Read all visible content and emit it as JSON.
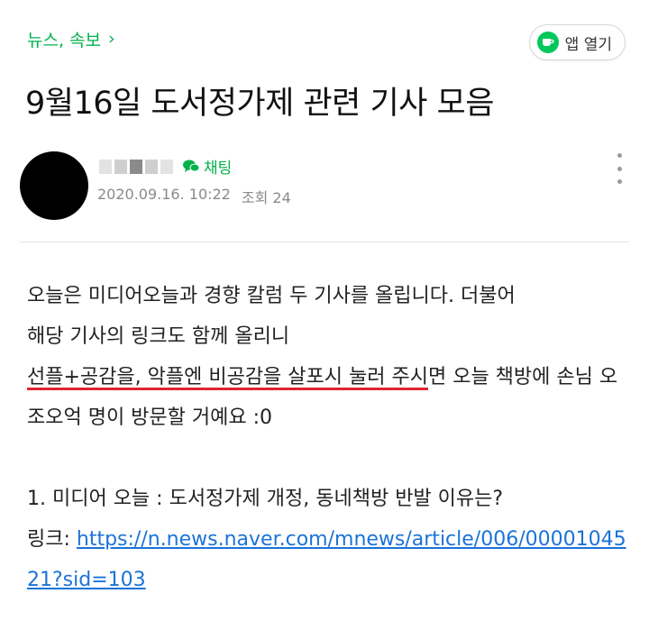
{
  "header": {
    "breadcrumb": "뉴스, 속보",
    "app_open_label": "앱 열기"
  },
  "post": {
    "title": "9월16일 도서정가제 관련 기사 모음",
    "chat_label": "채팅",
    "date": "2020.09.16. 10:22",
    "views": "조회 24"
  },
  "body": {
    "para1_line1": "오늘은 미디어오늘과 경향 칼럼 두 기사를 올립니다. 더불어",
    "para1_line2": "해당 기사의 링크도 함께 올리니",
    "para1_underlined": "선플+공감을, 악플엔 비공감을 살포시 눌러 주시",
    "para1_rest": "면 오늘 책방에 손님 오조오억 명이 방문할 거예요 :0",
    "item1_title": "1. 미디어 오늘 : 도서정가제 개정, 동네책방 반발 이유는?",
    "link_label": "링크: ",
    "link_url": "https://n.news.naver.com/mnews/article/006/0000104521?sid=103"
  },
  "colors": {
    "brand_green": "#03b14b",
    "link_blue": "#1b73d8",
    "underline_red": "#e0242e"
  },
  "icons": {
    "breadcrumb": "chevron-right-icon",
    "app": "cup-icon",
    "chat": "chat-bubble-icon",
    "more": "more-vertical-icon"
  }
}
